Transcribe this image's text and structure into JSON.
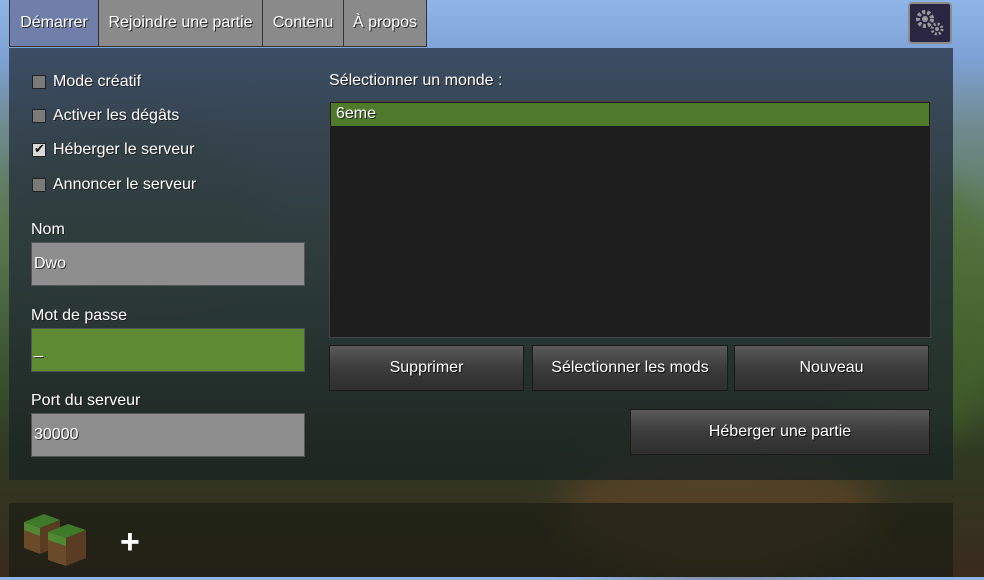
{
  "tabs": [
    {
      "label": "Démarrer",
      "active": true
    },
    {
      "label": "Rejoindre une partie",
      "active": false
    },
    {
      "label": "Contenu",
      "active": false
    },
    {
      "label": "À propos",
      "active": false
    }
  ],
  "settings_icon": "gear-icon",
  "options": [
    {
      "label": "Mode créatif",
      "checked": false
    },
    {
      "label": "Activer les dégâts",
      "checked": false
    },
    {
      "label": "Héberger le serveur",
      "checked": true
    },
    {
      "label": "Annoncer le serveur",
      "checked": false
    }
  ],
  "fields": {
    "name_label": "Nom",
    "name_value": "Dwo",
    "password_label": "Mot de passe",
    "password_value": "_",
    "port_label": "Port du serveur",
    "port_value": "30000"
  },
  "world_list": {
    "label": "Sélectionner un monde :",
    "items": [
      "6eme"
    ]
  },
  "buttons": {
    "delete": "Supprimer",
    "select_mods": "Sélectionner les mods",
    "new": "Nouveau",
    "host_game": "Héberger une partie"
  },
  "bottom_bar": {
    "game_icon": "grass-block-icon",
    "add_icon": "plus-icon",
    "add_symbol": "+"
  },
  "colors": {
    "active_tab": "#6f7faa",
    "selection_green": "#4f7a2c",
    "focused_field": "#5e8a33"
  }
}
